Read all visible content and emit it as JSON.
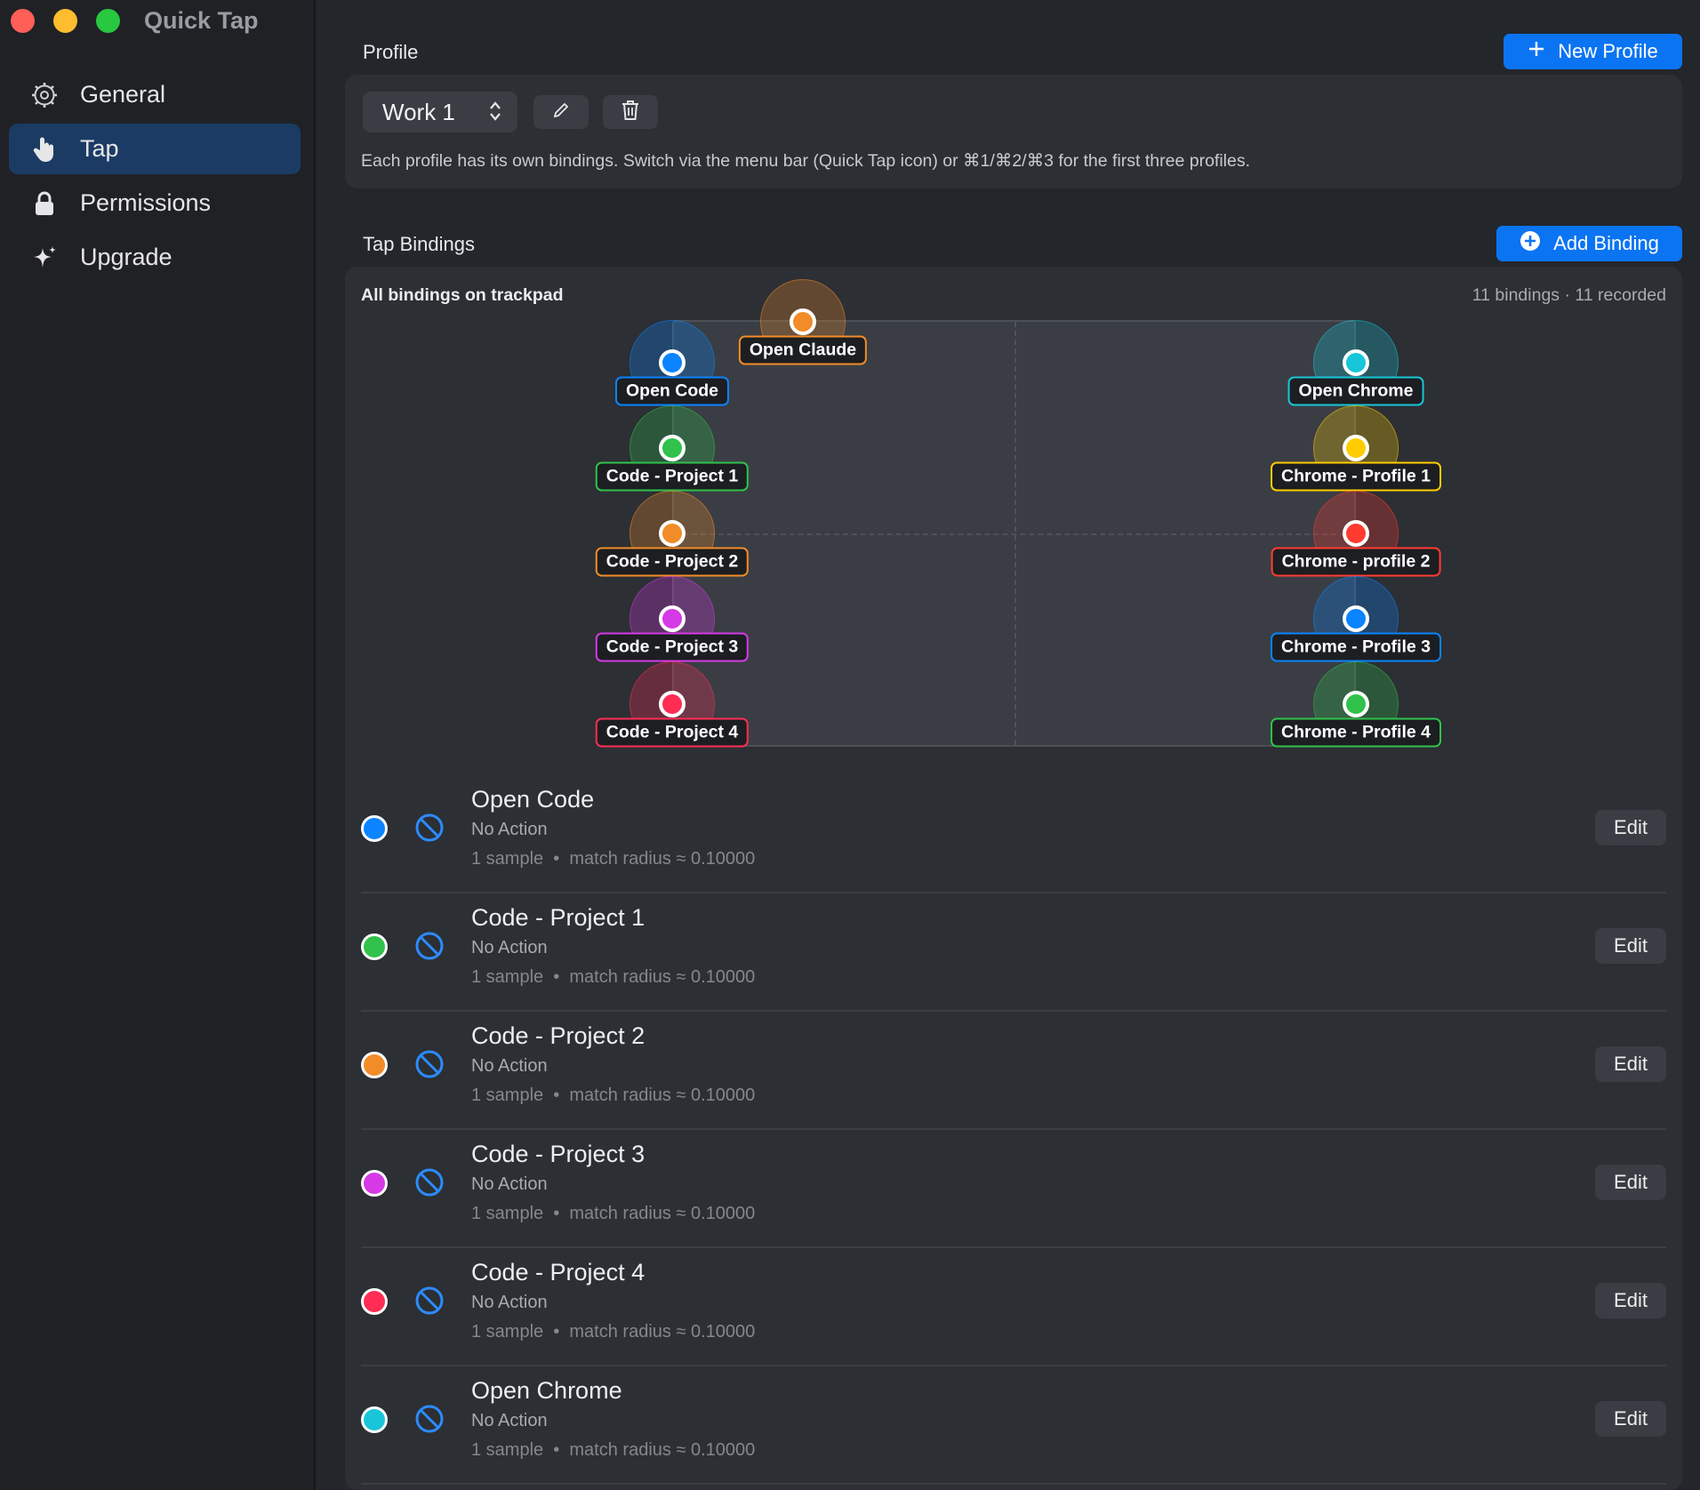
{
  "window": {
    "title": "Quick Tap",
    "traffic_colors": [
      "#ff5f57",
      "#febc2e",
      "#28c840"
    ]
  },
  "sidebar": {
    "items": [
      {
        "label": "General",
        "icon": "gear-icon"
      },
      {
        "label": "Tap",
        "icon": "hand-pointer-icon",
        "active": true
      },
      {
        "label": "Permissions",
        "icon": "lock-icon"
      },
      {
        "label": "Upgrade",
        "icon": "sparkle-icon"
      }
    ]
  },
  "profile": {
    "section_title": "Profile",
    "new_button": "New Profile",
    "selected": "Work 1",
    "help_text": "Each profile has its own bindings. Switch via the menu bar (Quick Tap icon) or ⌘1/⌘2/⌘3 for the first three profiles."
  },
  "tap_bindings": {
    "section_title": "Tap Bindings",
    "add_button": "Add Binding",
    "trackpad_title": "All bindings on trackpad",
    "count_text": "11 bindings · 11 recorded"
  },
  "pins": [
    {
      "label": "Open Claude",
      "color": "#f28c28"
    },
    {
      "label": "Open Code",
      "color": "#0a84ff"
    },
    {
      "label": "Open Chrome",
      "color": "#17c6d8"
    },
    {
      "label": "Code - Project 1",
      "color": "#30c24a"
    },
    {
      "label": "Chrome - Profile 1",
      "color": "#ffcc00"
    },
    {
      "label": "Code - Project 2",
      "color": "#f28c28"
    },
    {
      "label": "Chrome - profile 2",
      "color": "#ff3b30"
    },
    {
      "label": "Code - Project 3",
      "color": "#d63ae6"
    },
    {
      "label": "Chrome - Profile 3",
      "color": "#0a84ff"
    },
    {
      "label": "Code - Project 4",
      "color": "#ff2d55"
    },
    {
      "label": "Chrome - Profile 4",
      "color": "#30c24a"
    }
  ],
  "bindings": [
    {
      "name": "Open Code",
      "action": "No Action",
      "samples": "1 sample",
      "radius": "match radius ≈ 0.10000",
      "color": "#0a84ff",
      "edit": "Edit"
    },
    {
      "name": "Code - Project 1",
      "action": "No Action",
      "samples": "1 sample",
      "radius": "match radius ≈ 0.10000",
      "color": "#30c24a",
      "edit": "Edit"
    },
    {
      "name": "Code - Project 2",
      "action": "No Action",
      "samples": "1 sample",
      "radius": "match radius ≈ 0.10000",
      "color": "#f28c28",
      "edit": "Edit"
    },
    {
      "name": "Code - Project 3",
      "action": "No Action",
      "samples": "1 sample",
      "radius": "match radius ≈ 0.10000",
      "color": "#d63ae6",
      "edit": "Edit"
    },
    {
      "name": "Code - Project 4",
      "action": "No Action",
      "samples": "1 sample",
      "radius": "match radius ≈ 0.10000",
      "color": "#ff2d55",
      "edit": "Edit"
    },
    {
      "name": "Open Chrome",
      "action": "No Action",
      "samples": "1 sample",
      "radius": "match radius ≈ 0.10000",
      "color": "#17c6d8",
      "edit": "Edit"
    }
  ]
}
